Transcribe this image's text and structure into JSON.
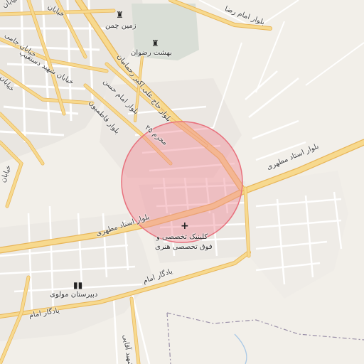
{
  "map": {
    "colors": {
      "background": "#f2efe9",
      "residential": "#e8e4df",
      "cemetery": "#d7ddd4",
      "major_road": "#f7d98e",
      "major_road_casing": "#e8b65a",
      "minor_road": "#ffffff",
      "minor_road_casing": "#d4cfc6",
      "boundary": "#9a8fa8",
      "stream": "#a9c8e6",
      "highlight_fill": "#f08c96",
      "highlight_stroke": "#e8717d"
    },
    "road_labels": {
      "ostad_motahari_east": "بلوار استاد مطهری",
      "ostad_motahari_west": "بلوار استاد مطهری",
      "ali_akbar_rahmanian": "بلوار حاج علی اکبر رحمانیان",
      "imam_hassan": "بلوار امام حسن",
      "moharram_25": "۲۵ محرم",
      "fatemiyoon": "بلوار فاطمیون",
      "yadegar_imam_1": "یادگار امام",
      "yadegar_imam_2": "یادگار امام",
      "shahid_dastgheib": "خیابان شهید دستغیب",
      "khayaban_jami": "خیابان جامی",
      "khayaban_a": "خیابان",
      "khayaban_b": "خیابان",
      "khayaban_c": "خیابان",
      "khayaban_d": "خیابان",
      "imam_reza_top": "بلوار امام رضا",
      "shahid_aghaei": "شهید آقایی"
    },
    "pois": {
      "zamin_chaman": {
        "label": "زمین چمن",
        "icon": "sports-icon"
      },
      "behesht_rezvan": {
        "label": "بهشت رضوان",
        "icon": "cemetery-icon"
      },
      "clinic": {
        "label_line1": "کلینیک تخصصی و",
        "label_line2": "فوق تخصصی هنری",
        "icon": "hospital-cross-icon"
      },
      "molavi_school": {
        "label": "دبیرستان مولوی",
        "icon": "school-icon"
      }
    },
    "highlight_area": {
      "shape": "circle",
      "meaning": "selected area"
    }
  }
}
